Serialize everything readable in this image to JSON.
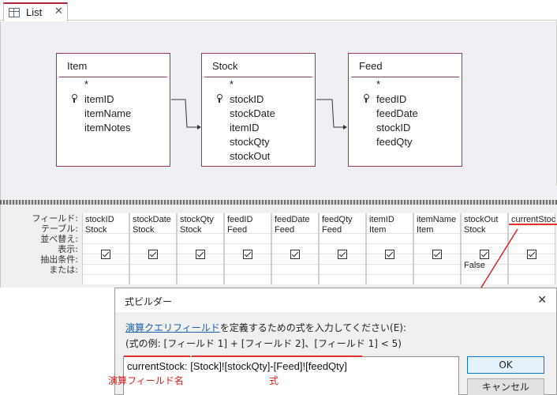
{
  "tab": {
    "label": "List",
    "close_glyph": "✕",
    "icon": "table-icon"
  },
  "tables": [
    {
      "name": "Item",
      "fields": [
        {
          "name": "*",
          "key": false
        },
        {
          "name": "itemID",
          "key": true
        },
        {
          "name": "itemName",
          "key": false
        },
        {
          "name": "itemNotes",
          "key": false
        }
      ]
    },
    {
      "name": "Stock",
      "fields": [
        {
          "name": "*",
          "key": false
        },
        {
          "name": "stockID",
          "key": true
        },
        {
          "name": "stockDate",
          "key": false
        },
        {
          "name": "itemID",
          "key": false
        },
        {
          "name": "stockQty",
          "key": false
        },
        {
          "name": "stockOut",
          "key": false
        }
      ]
    },
    {
      "name": "Feed",
      "fields": [
        {
          "name": "*",
          "key": false
        },
        {
          "name": "feedID",
          "key": true
        },
        {
          "name": "feedDate",
          "key": false
        },
        {
          "name": "stockID",
          "key": false
        },
        {
          "name": "feedQty",
          "key": false
        }
      ]
    }
  ],
  "grid": {
    "row_labels": [
      "フィールド:",
      "テーブル:",
      "並べ替え:",
      "表示:",
      "抽出条件:",
      "または:"
    ],
    "columns": [
      {
        "field": "stockID",
        "table": "Stock",
        "show": true,
        "criteria": ""
      },
      {
        "field": "stockDate",
        "table": "Stock",
        "show": true,
        "criteria": ""
      },
      {
        "field": "stockQty",
        "table": "Stock",
        "show": true,
        "criteria": ""
      },
      {
        "field": "feedID",
        "table": "Feed",
        "show": true,
        "criteria": ""
      },
      {
        "field": "feedDate",
        "table": "Feed",
        "show": true,
        "criteria": ""
      },
      {
        "field": "feedQty",
        "table": "Feed",
        "show": true,
        "criteria": ""
      },
      {
        "field": "itemID",
        "table": "Item",
        "show": true,
        "criteria": ""
      },
      {
        "field": "itemName",
        "table": "Item",
        "show": true,
        "criteria": ""
      },
      {
        "field": "stockOut",
        "table": "Stock",
        "show": true,
        "criteria": "False"
      },
      {
        "field": "currentStoc",
        "table": "",
        "show": true,
        "criteria": ""
      }
    ]
  },
  "dialog": {
    "title": "式ビルダー",
    "close_glyph": "✕",
    "instruction_link": "演算クエリフィールド",
    "instruction_rest": "を定義するための式を入力してください(E):",
    "example": "(式の例: [フィールド 1] + [フィールド 2]、[フィールド 1] < 5)",
    "expression": "currentStock: [Stock]![stockQty]-[Feed]![feedQty]",
    "ok_label": "OK",
    "cancel_label": "キャンセル"
  },
  "annotations": {
    "field_name_label": "演算フィールド名",
    "expression_label": "式",
    "color": "#e02020"
  }
}
